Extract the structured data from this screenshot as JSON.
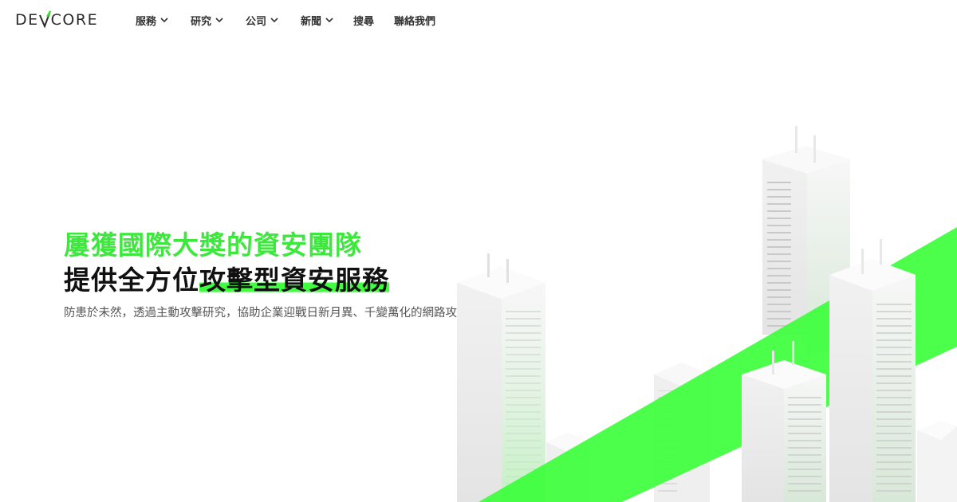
{
  "header": {
    "logo_text_left": "DE",
    "logo_text_right": "CORE",
    "logo_mark": "checkmark-V",
    "nav": [
      {
        "label": "服務",
        "has_dropdown": true
      },
      {
        "label": "研究",
        "has_dropdown": true
      },
      {
        "label": "公司",
        "has_dropdown": true
      },
      {
        "label": "新聞",
        "has_dropdown": true
      },
      {
        "label": "搜尋",
        "has_dropdown": false
      },
      {
        "label": "聯絡我們",
        "has_dropdown": false
      }
    ]
  },
  "hero": {
    "title_line1": "屢獲國際大獎的資安團隊",
    "title_line2_plain": "提供全方位",
    "title_line2_highlight": "攻擊型資安服務",
    "subtitle": "防患於未然，透過主動攻擊研究，協助企業迎戰日新月異、千變萬化的網路攻擊型態"
  },
  "colors": {
    "accent_green": "#3de83d",
    "highlight_green": "#3fff3f",
    "text_dark": "#111111",
    "text_muted": "#555555"
  },
  "icons": {
    "dropdown": "chevron-down-icon",
    "illustration": "isometric-city-buildings"
  }
}
